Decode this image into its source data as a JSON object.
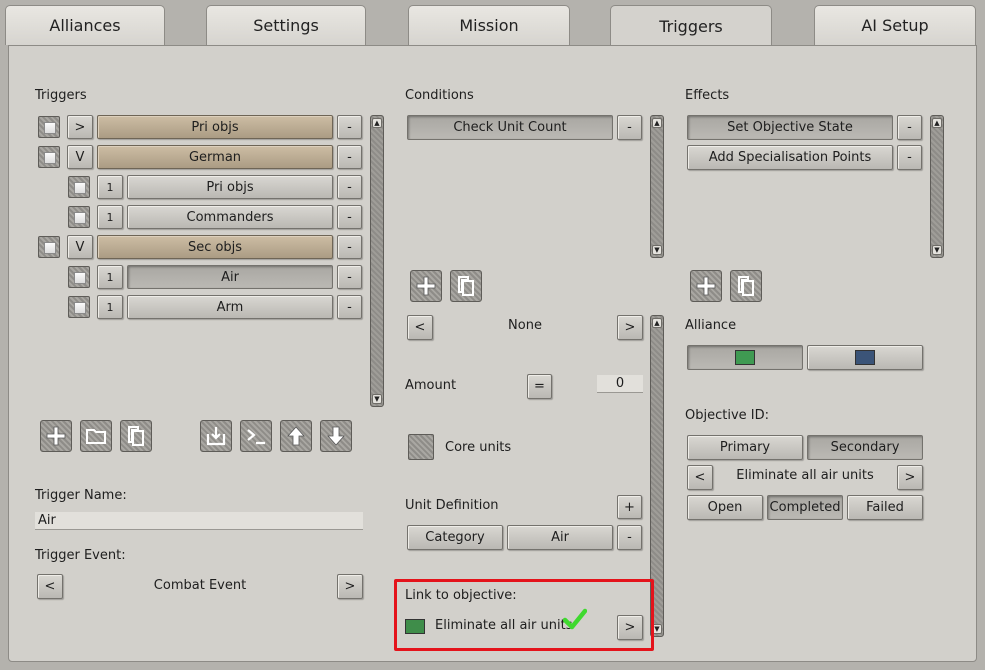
{
  "tabs": [
    "Alliances",
    "Settings",
    "Mission",
    "Triggers",
    "AI Setup"
  ],
  "triggers_panel": {
    "heading": "Triggers",
    "rows": [
      {
        "toggle": ">",
        "label": "Pri objs"
      },
      {
        "toggle": "V",
        "label": "German"
      },
      {
        "toggle": "1",
        "label": "Pri objs"
      },
      {
        "toggle": "1",
        "label": "Commanders"
      },
      {
        "toggle": "V",
        "label": "Sec objs"
      },
      {
        "toggle": "1",
        "label": "Air"
      },
      {
        "toggle": "1",
        "label": "Arm"
      }
    ],
    "remove_label": "-",
    "trigger_name_label": "Trigger Name:",
    "trigger_name_value": "Air",
    "trigger_event_label": "Trigger Event:",
    "trigger_event_value": "Combat Event",
    "prev": "<",
    "next": ">"
  },
  "conditions_panel": {
    "heading": "Conditions",
    "items": [
      "Check Unit Count"
    ],
    "remove_label": "-",
    "selector_value": "None",
    "prev": "<",
    "next": ">",
    "amount_label": "Amount",
    "amount_operator": "=",
    "amount_value": "0",
    "core_units_label": "Core units",
    "unit_definition_label": "Unit Definition",
    "unit_definition_add": "+",
    "unit_definition_type": "Category",
    "unit_definition_value": "Air",
    "link_label": "Link to objective:",
    "link_value": "Eliminate all air units",
    "link_color": "#3f8d4a",
    "check_color": "#3fd92f"
  },
  "effects_panel": {
    "heading": "Effects",
    "items": [
      "Set Objective State",
      "Add Specialisation Points"
    ],
    "remove_label": "-",
    "alliance_label": "Alliance",
    "alliance_colors": [
      "#3f9a52",
      "#3b5478"
    ],
    "objective_id_label": "Objective ID:",
    "objective_types": [
      "Primary",
      "Secondary"
    ],
    "objective_value": "Eliminate all air units",
    "prev": "<",
    "next": ">",
    "states": [
      "Open",
      "Completed",
      "Failed"
    ]
  },
  "colors": {
    "highlight": "#e4131b",
    "trigger_group": "#c0b096"
  }
}
